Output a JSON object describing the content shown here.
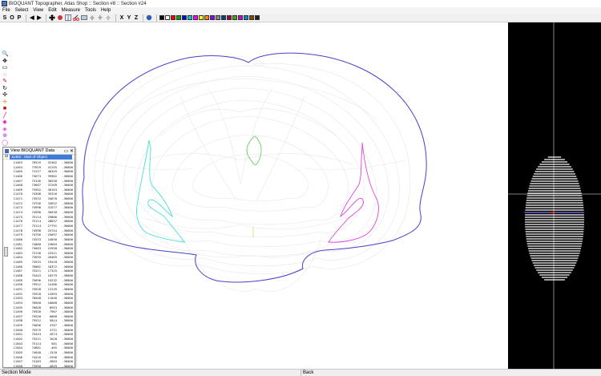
{
  "window": {
    "title": "BIOQUANT Topographer, Atlas Shop :: Section #8 :: Section #24"
  },
  "menu": [
    "File",
    "Select",
    "View",
    "Edit",
    "Measure",
    "Tools",
    "Help"
  ],
  "toolbar": {
    "mode_buttons": [
      "S",
      "O",
      "P"
    ],
    "axis_buttons": [
      "X",
      "Y",
      "Z"
    ],
    "palette": [
      "#000000",
      "#ffffff",
      "#ff0000",
      "#00aa00",
      "#0000ff",
      "#00cccc",
      "#ff00ff",
      "#ffff00",
      "#ff8800",
      "#8800ff",
      "#888888",
      "#004488",
      "#aa0044",
      "#44aa00",
      "#cc00cc",
      "#0088cc",
      "#884400",
      "#222222"
    ]
  },
  "left_tools": [
    "magnify-icon",
    "move-icon",
    "select-icon",
    "lasso-icon",
    "pen-icon",
    "rotate-icon",
    "pan-icon",
    "crosshair-icon",
    "trace-icon",
    "line-icon",
    "erase-icon",
    "fill-icon",
    "measure-icon",
    "point-icon",
    "z-icon",
    "undo-icon"
  ],
  "data_window": {
    "title": "View BIOQUANT Data",
    "header_label": "11462 : Start of Object",
    "rows": [
      [
        "11463",
        "76529",
        "32462",
        "-36000"
      ],
      [
        "11464",
        "77629",
        "41155",
        "-36000"
      ],
      [
        "11465",
        "72227",
        "40349",
        "-36000"
      ],
      [
        "11466",
        "73673",
        "39902",
        "-36000"
      ],
      [
        "11467",
        "73136",
        "38258",
        "-36000"
      ],
      [
        "11468",
        "73607",
        "37209",
        "-36000"
      ],
      [
        "11469",
        "73952",
        "36163",
        "-36000"
      ],
      [
        "11470",
        "74308",
        "35316",
        "-36000"
      ],
      [
        "11471",
        "74533",
        "34670",
        "-36000"
      ],
      [
        "11472",
        "74756",
        "33622",
        "-36000"
      ],
      [
        "11473",
        "74998",
        "31577",
        "-36000"
      ],
      [
        "11474",
        "74998",
        "30530",
        "-36000"
      ],
      [
        "11475",
        "75114",
        "29886",
        "-36000"
      ],
      [
        "11476",
        "75114",
        "28837",
        "-36000"
      ],
      [
        "11477",
        "75114",
        "27791",
        "-36000"
      ],
      [
        "11478",
        "74998",
        "25744",
        "-36000"
      ],
      [
        "11479",
        "74756",
        "25697",
        "-36000"
      ],
      [
        "11480",
        "74533",
        "24650",
        "-36000"
      ],
      [
        "11481",
        "74068",
        "23604",
        "-36000"
      ],
      [
        "11482",
        "73603",
        "22958",
        "-36000"
      ],
      [
        "11483",
        "73136",
        "22511",
        "-36000"
      ],
      [
        "11484",
        "73035",
        "20465",
        "-36000"
      ],
      [
        "11485",
        "74533",
        "19418",
        "-36000"
      ],
      [
        "11486",
        "76882",
        "18372",
        "-36000"
      ],
      [
        "11487",
        "75221",
        "17325",
        "-36000"
      ],
      [
        "11488",
        "75443",
        "16279",
        "-36000"
      ],
      [
        "11489",
        "75696",
        "15232",
        "-36000"
      ],
      [
        "11490",
        "75912",
        "14186",
        "-36000"
      ],
      [
        "11491",
        "75928",
        "13139",
        "-36000"
      ],
      [
        "11492",
        "75928",
        "12093",
        "-36000"
      ],
      [
        "11493",
        "76048",
        "11046",
        "-36000"
      ],
      [
        "11494",
        "76048",
        "10000",
        "-36000"
      ],
      [
        "11495",
        "76048",
        "8953",
        "-36000"
      ],
      [
        "11496",
        "75928",
        "7907",
        "-36000"
      ],
      [
        "11497",
        "75928",
        "6860",
        "-36000"
      ],
      [
        "11498",
        "75912",
        "5814",
        "-36000"
      ],
      [
        "11499",
        "75696",
        "4767",
        "-36000"
      ],
      [
        "11500",
        "75579",
        "3721",
        "-36000"
      ],
      [
        "11501",
        "75443",
        "2674",
        "-36000"
      ],
      [
        "11502",
        "75221",
        "1628",
        "-36000"
      ],
      [
        "11503",
        "75114",
        "581",
        "-36000"
      ],
      [
        "11504",
        "74681",
        "-465",
        "-36000"
      ],
      [
        "11505",
        "74648",
        "-1510",
        "-36000"
      ],
      [
        "11506",
        "74416",
        "-2556",
        "-36000"
      ],
      [
        "11507",
        "74183",
        "-3603",
        "-36000"
      ],
      [
        "11508",
        "73950",
        "-4649",
        "-36000"
      ],
      [
        "11509",
        "73602",
        "-5696",
        "-36000"
      ],
      [
        "11510",
        "73269",
        "-6742",
        "-36000"
      ],
      [
        "11511",
        "73009",
        "-7789",
        "-36000"
      ]
    ]
  },
  "status": {
    "left": "Section Mode",
    "right": "Back"
  }
}
